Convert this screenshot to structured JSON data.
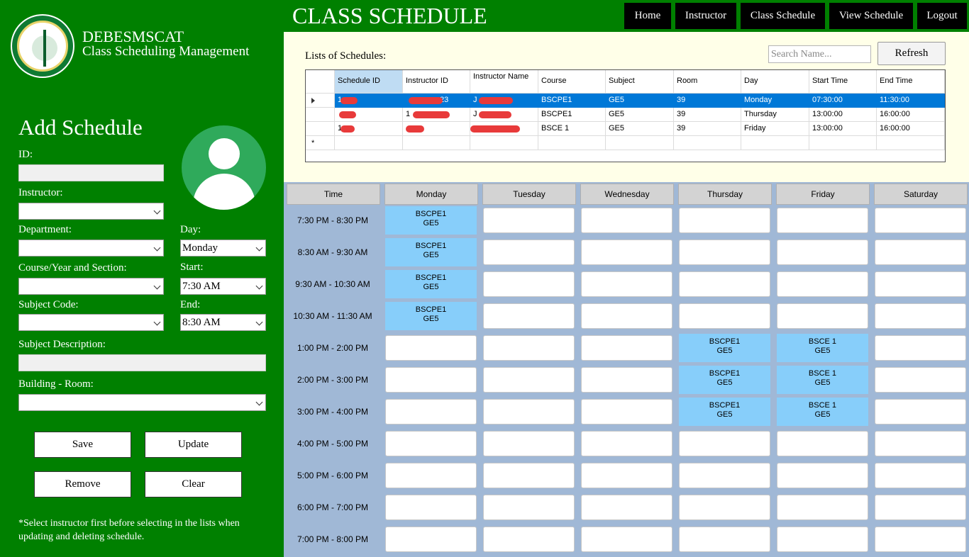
{
  "brand": {
    "line1": "DEBESMSCAT",
    "line2": "Class Scheduling Management"
  },
  "header": {
    "title": "CLASS SCHEDULE"
  },
  "nav": {
    "items": [
      "Home",
      "Instructor",
      "Class Schedule",
      "View Schedule",
      "Logout"
    ]
  },
  "form": {
    "title": "Add Schedule",
    "labels": {
      "id": "ID:",
      "instructor": "Instructor:",
      "department": "Department:",
      "day": "Day:",
      "course": "Course/Year and Section:",
      "start": "Start:",
      "subject_code": "Subject Code:",
      "end": "End:",
      "subject_description": "Subject Description:",
      "building_room": "Building - Room:"
    },
    "values": {
      "day": "Monday",
      "start": "7:30 AM",
      "end": "8:30 AM"
    },
    "buttons": {
      "save": "Save",
      "update": "Update",
      "remove": "Remove",
      "clear": "Clear"
    },
    "note": "*Select instructor first before selecting in the lists when updating and deleting schedule."
  },
  "schedule_list": {
    "label": "Lists of Schedules:",
    "search_placeholder": "Search Name...",
    "refresh": "Refresh",
    "columns": [
      "Schedule ID",
      "Instructor ID",
      "Instructor Name",
      "Course",
      "Subject",
      "Room",
      "Day",
      "Start Time",
      "End Time"
    ],
    "rows": [
      {
        "course": "BSCPE1",
        "subject": "GE5",
        "room": "39",
        "day": "Monday",
        "start": "07:30:00",
        "end": "11:30:00",
        "id_partial": "1",
        "instructor_id_partial": "23",
        "instructor_name_partial": "J"
      },
      {
        "course": "BSCPE1",
        "subject": "GE5",
        "room": "39",
        "day": "Thursday",
        "start": "13:00:00",
        "end": "16:00:00",
        "id_partial": "",
        "instructor_id_partial": "1",
        "instructor_name_partial": "J"
      },
      {
        "course": "BSCE 1",
        "subject": "GE5",
        "room": "39",
        "day": "Friday",
        "start": "13:00:00",
        "end": "16:00:00",
        "id_partial": "1",
        "instructor_id_partial": "",
        "instructor_name_partial": ""
      }
    ],
    "new_row_marker": "*"
  },
  "timetable": {
    "headers": [
      "Time",
      "Monday",
      "Tuesday",
      "Wednesday",
      "Thursday",
      "Friday",
      "Saturday"
    ],
    "times": [
      "7:30 PM - 8:30 PM",
      "8:30 AM - 9:30 AM",
      "9:30 AM - 10:30 AM",
      "10:30 AM - 11:30 AM",
      "1:00 PM - 2:00 PM",
      "2:00 PM - 3:00 PM",
      "3:00 PM - 4:00 PM",
      "4:00 PM - 5:00 PM",
      "5:00 PM - 6:00 PM",
      "6:00 PM - 7:00 PM",
      "7:00 PM - 8:00 PM"
    ],
    "cells": [
      [
        "BSCPE1\nGE5",
        "",
        "",
        "",
        "",
        ""
      ],
      [
        "BSCPE1\nGE5",
        "",
        "",
        "",
        "",
        ""
      ],
      [
        "BSCPE1\nGE5",
        "",
        "",
        "",
        "",
        ""
      ],
      [
        "BSCPE1\nGE5",
        "",
        "",
        "",
        "",
        ""
      ],
      [
        "",
        "",
        "",
        "BSCPE1\nGE5",
        "BSCE 1\nGE5",
        ""
      ],
      [
        "",
        "",
        "",
        "BSCPE1\nGE5",
        "BSCE 1\nGE5",
        ""
      ],
      [
        "",
        "",
        "",
        "BSCPE1\nGE5",
        "BSCE 1\nGE5",
        ""
      ],
      [
        "",
        "",
        "",
        "",
        "",
        ""
      ],
      [
        "",
        "",
        "",
        "",
        "",
        ""
      ],
      [
        "",
        "",
        "",
        "",
        "",
        ""
      ],
      [
        "",
        "",
        "",
        "",
        "",
        ""
      ]
    ]
  }
}
